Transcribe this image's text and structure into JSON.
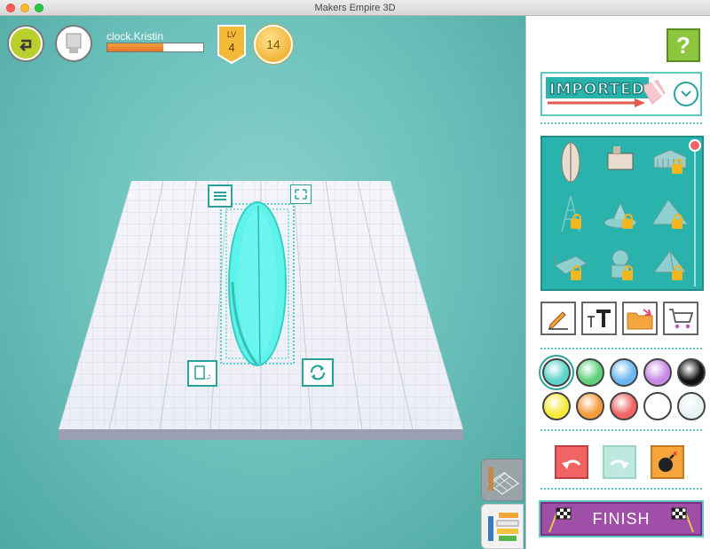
{
  "window": {
    "title": "Makers Empire 3D"
  },
  "user": {
    "name": "clock.Kristin",
    "xp_fraction": 0.58,
    "level_label": "LV",
    "level": "4",
    "coins": "14"
  },
  "panel": {
    "help": "?",
    "category": "IMPORTED",
    "finish_label": "FINISH"
  },
  "colors": {
    "swatches": [
      "#5fd3cb",
      "#5fd07c",
      "#6ab7f2",
      "#c789e3",
      "#111111",
      "#f5ea3a",
      "#f49a3a",
      "#f06464",
      "#ffffff",
      "#e6f3f3"
    ],
    "accent": "#5fc7c1",
    "finish": "#a04fa8"
  },
  "icons": {
    "back": "back-arrow-icon",
    "menu": "menu-lines-icon",
    "resize": "expand-arrows-icon",
    "scale": "scale-icon",
    "rotate": "rotate-icon",
    "pencil": "pencil-icon",
    "text": "text-tool-icon",
    "folder": "folder-icon",
    "cart": "cart-icon",
    "undo": "undo-icon",
    "redo": "redo-icon",
    "bomb": "bomb-icon"
  }
}
